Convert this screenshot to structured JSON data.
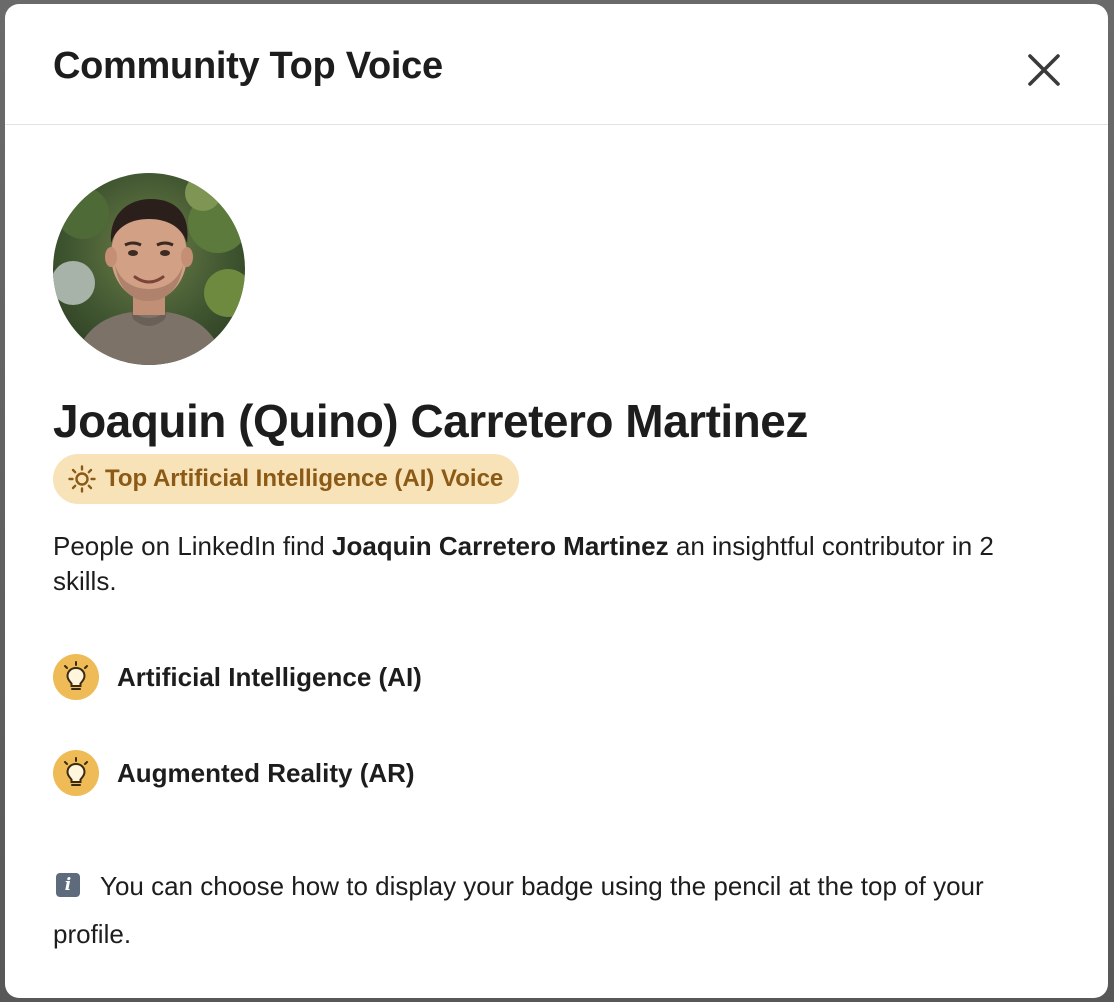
{
  "modal": {
    "title": "Community Top Voice",
    "close_label": "Close"
  },
  "profile": {
    "name": "Joaquin (Quino) Carretero Martinez",
    "badge_label": "Top Artificial Intelligence (AI) Voice"
  },
  "description": {
    "prefix": "People on LinkedIn find ",
    "name": "Joaquin Carretero Martinez",
    "suffix": " an insightful contributor in 2 skills."
  },
  "skills": [
    {
      "label": "Artificial Intelligence (AI)",
      "icon": "lightbulb-icon"
    },
    {
      "label": "Augmented Reality (AR)",
      "icon": "lightbulb-icon"
    }
  ],
  "info": {
    "icon": "info-icon",
    "text": "You can choose how to display your badge using the pencil at the top of your profile."
  },
  "colors": {
    "badge_bg": "#f8e3b8",
    "badge_text": "#8a5a16",
    "skill_icon_bg": "#eebb56",
    "text": "#1d1d1d"
  }
}
